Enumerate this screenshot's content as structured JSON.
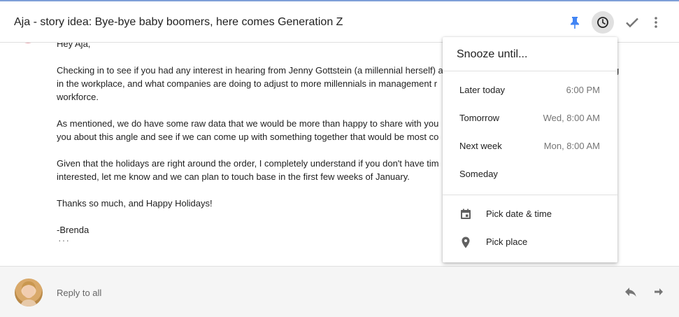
{
  "email": {
    "subject": "Aja - story idea: Bye-bye baby boomers, here comes Generation Z",
    "greeting": "Hey Aja,",
    "paragraphs": [
      {
        "line1": "Checking in to see if you had any interest in hearing from Jenny Gottstein (a millennial herself) a",
        "line2": "in the workplace, and what companies are doing to adjust to more millennials in management r",
        "line3": "workforce.",
        "trailing": "g"
      },
      {
        "line1": "As mentioned, we do have some raw data that we would be more than happy to share with you",
        "line2": "you about this angle and see if we can come up with something together that would be most co"
      },
      {
        "line1": "Given that the holidays are right around the order, I completely understand if you don't have tim",
        "line2": "interested, let me know and we can plan to touch base in the first few weeks of January."
      }
    ],
    "closing": "Thanks so much, and Happy Holidays!",
    "signature": "-Brenda",
    "trimmed_indicator": "···"
  },
  "header_icons": [
    "pin-icon",
    "snooze-clock-icon",
    "done-check-icon",
    "more-vert-icon"
  ],
  "reply": {
    "label": "Reply to all"
  },
  "snooze_menu": {
    "title": "Snooze until...",
    "options": [
      {
        "label": "Later today",
        "time": "6:00 PM"
      },
      {
        "label": "Tomorrow",
        "time": "Wed, 8:00 AM"
      },
      {
        "label": "Next week",
        "time": "Mon, 8:00 AM"
      },
      {
        "label": "Someday",
        "time": ""
      }
    ],
    "pick_date_label": "Pick date & time",
    "pick_place_label": "Pick place"
  },
  "colors": {
    "pin_accent": "#4285f4",
    "icon_gray": "#5f6368"
  }
}
